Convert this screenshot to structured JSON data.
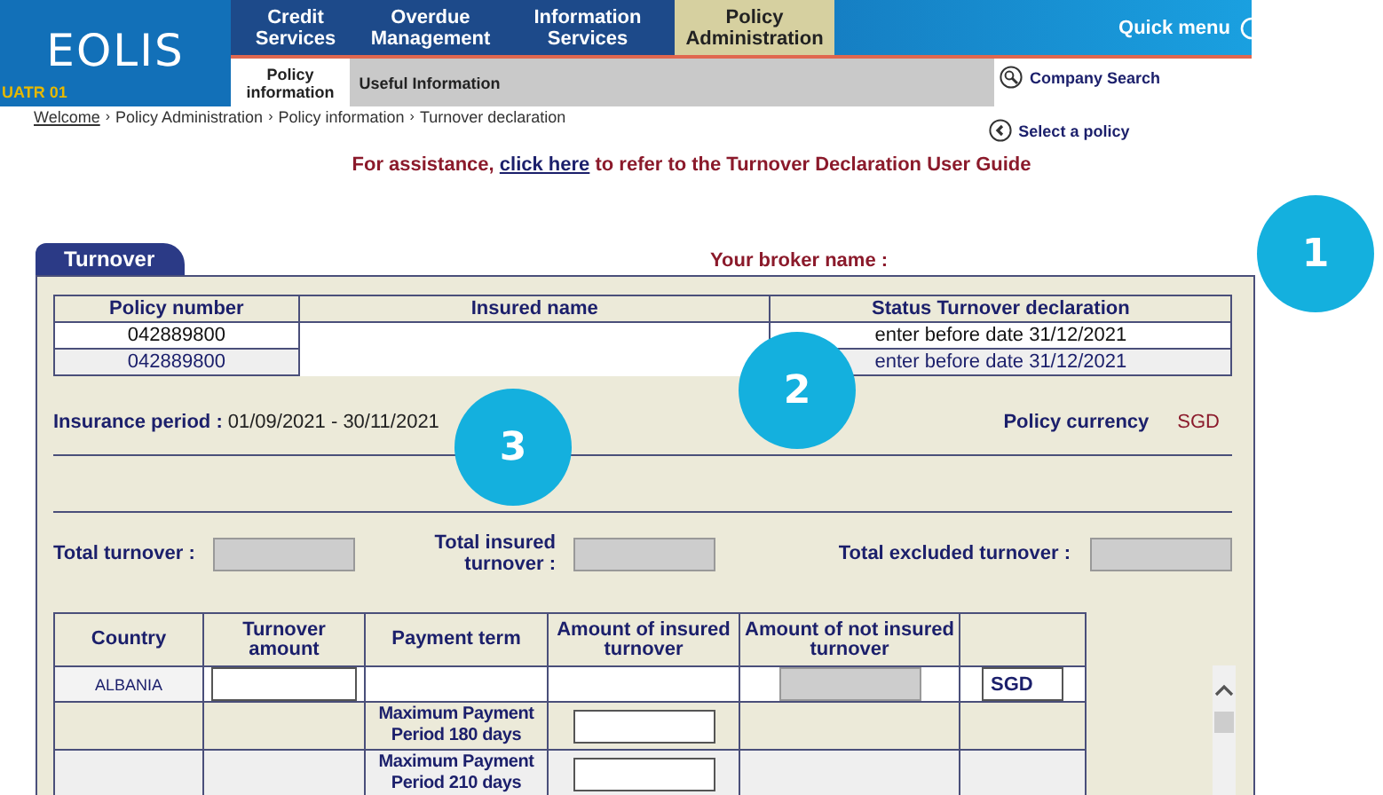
{
  "header": {
    "logo": "EOLIS",
    "environment": "UATR 01",
    "nav": [
      {
        "label": "Credit Services",
        "selected": false
      },
      {
        "label": "Overdue Management",
        "selected": false
      },
      {
        "label": "Information Services",
        "selected": false
      },
      {
        "label": "Policy Administration",
        "selected": true
      }
    ],
    "quick_menu": "Quick menu",
    "subnav": [
      {
        "label": "Policy information",
        "selected": true
      },
      {
        "label": "Useful Information",
        "selected": false
      }
    ],
    "links": [
      {
        "label": "Company Search",
        "kind": "search"
      },
      {
        "label": "Select a policy",
        "kind": "back"
      }
    ]
  },
  "breadcrumb_separator": "›",
  "breadcrumb": [
    {
      "label": "Welcome",
      "link": true
    },
    {
      "label": "Policy Administration",
      "link": false
    },
    {
      "label": "Policy information",
      "link": false
    },
    {
      "label": "Turnover declaration",
      "link": false
    }
  ],
  "assistance": {
    "before": "For assistance,",
    "link": "click here",
    "after": "to refer to the Turnover Declaration User Guide"
  },
  "panel": {
    "tab": "Turnover",
    "broker_label": "Your broker name :",
    "policy_table": {
      "columns": [
        "Policy number",
        "Insured name",
        "Status Turnover declaration"
      ],
      "rows": [
        {
          "policy": "042889800",
          "status": "enter before date 31/12/2021"
        },
        {
          "policy": "042889800",
          "status": "enter before date 31/12/2021"
        }
      ]
    },
    "insurance_period_label": "Insurance period :",
    "insurance_period": "01/09/2021 - 30/11/2021",
    "currency_label": "Policy currency",
    "currency": "SGD",
    "totals": [
      {
        "label": "Total turnover :"
      },
      {
        "label": "Total insured turnover :"
      },
      {
        "label": "Total excluded turnover :"
      }
    ],
    "country_table": {
      "columns": [
        "Country",
        "Turnover amount",
        "Payment term",
        "Amount of insured turnover",
        "Amount of not insured turnover"
      ],
      "rows": [
        {
          "kind": "country",
          "country": "ALBANIA",
          "currency": "SGD"
        },
        {
          "kind": "term",
          "payment_term": "Maximum Payment Period 180 days"
        },
        {
          "kind": "term",
          "payment_term": "Maximum Payment Period 210 days"
        }
      ]
    }
  },
  "callouts": [
    "1",
    "2",
    "3"
  ]
}
